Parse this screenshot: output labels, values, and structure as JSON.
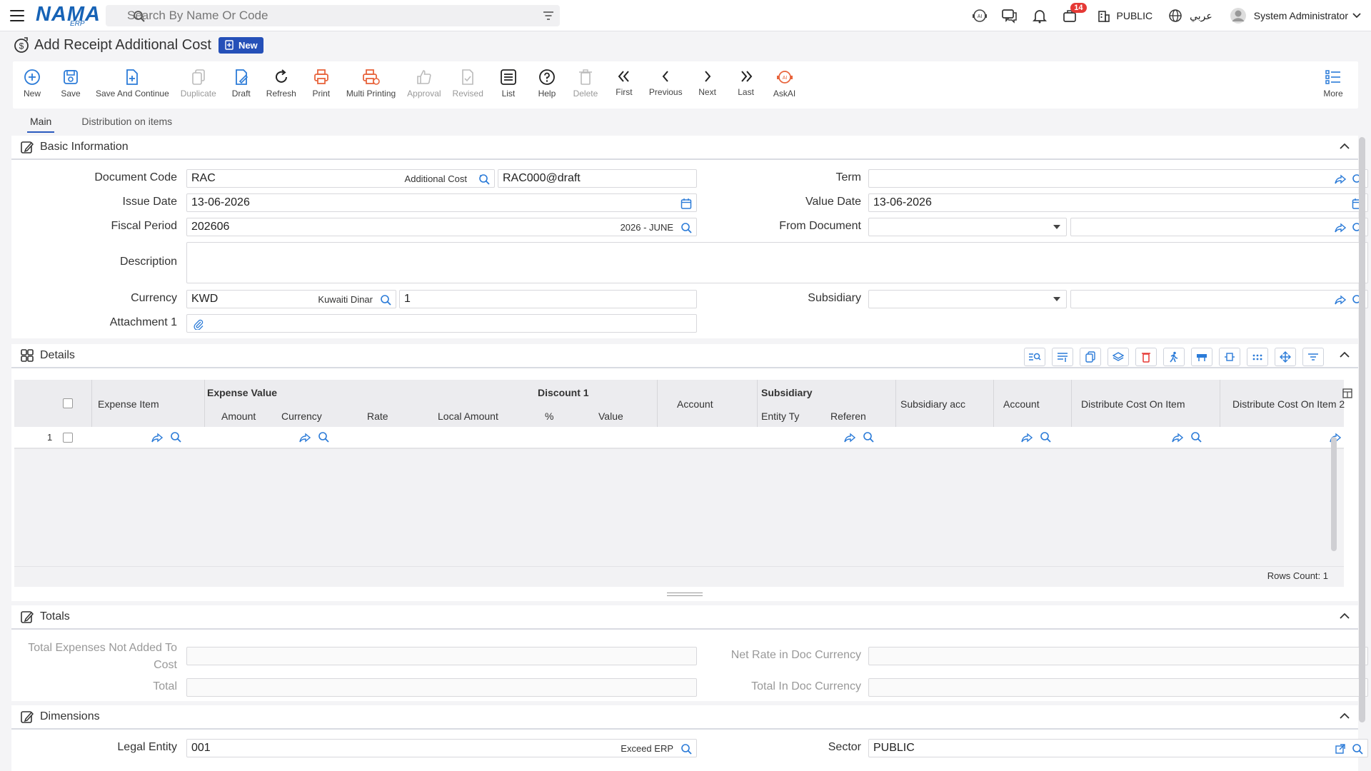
{
  "topbar": {
    "logo_main": "NAMA",
    "logo_sub": "ERP",
    "search_placeholder": "Search By Name Or Code",
    "notification_count": "14",
    "company": "PUBLIC",
    "language": "عربي",
    "user": "System Administrator"
  },
  "page": {
    "title": "Add Receipt Additional Cost",
    "status_badge": "New"
  },
  "toolbar": {
    "new": "New",
    "save": "Save",
    "save_continue": "Save And Continue",
    "duplicate": "Duplicate",
    "draft": "Draft",
    "refresh": "Refresh",
    "print": "Print",
    "multi_printing": "Multi Printing",
    "approval": "Approval",
    "revised": "Revised",
    "list": "List",
    "help": "Help",
    "delete": "Delete",
    "first": "First",
    "previous": "Previous",
    "next": "Next",
    "last": "Last",
    "askai": "AskAI",
    "more": "More"
  },
  "tabs": {
    "main": "Main",
    "distribution": "Distribution on items"
  },
  "basic": {
    "title": "Basic Information",
    "document_code_label": "Document Code",
    "document_code": "RAC",
    "document_code_tag": "Additional Cost",
    "document_number": "RAC000@draft",
    "term_label": "Term",
    "issue_date_label": "Issue Date",
    "issue_date": "13-06-2026",
    "value_date_label": "Value Date",
    "value_date": "13-06-2026",
    "fiscal_period_label": "Fiscal Period",
    "fiscal_period": "202606",
    "fiscal_period_tag": "2026 - JUNE",
    "from_document_label": "From Document",
    "description_label": "Description",
    "currency_label": "Currency",
    "currency": "KWD",
    "currency_tag": "Kuwaiti Dinar",
    "rate": "1",
    "subsidiary_label": "Subsidiary",
    "attachment_label": "Attachment 1"
  },
  "details": {
    "title": "Details",
    "columns": {
      "expense_item": "Expense Item",
      "expense_value": "Expense Value",
      "amount": "Amount",
      "currency": "Currency",
      "rate": "Rate",
      "local_amount": "Local Amount",
      "discount1": "Discount 1",
      "pct": "%",
      "value": "Value",
      "account": "Account",
      "subsidiary": "Subsidiary",
      "entity_type": "Entity Ty",
      "reference": "Referen",
      "subsidiary_account": "Subsidiary acc",
      "account2": "Account",
      "distribute_cost": "Distribute Cost On Item",
      "distribute_cost2": "Distribute Cost On Item 2"
    },
    "row_number": "1",
    "rows_count": "Rows Count: 1"
  },
  "totals": {
    "title": "Totals",
    "total_expenses_label_1": "Total Expenses Not Added To",
    "total_expenses_label_2": "Cost",
    "net_rate_label": "Net Rate in Doc Currency",
    "total_label": "Total",
    "total_doc_label": "Total In Doc Currency"
  },
  "dimensions": {
    "title": "Dimensions",
    "legal_entity_label": "Legal Entity",
    "legal_entity": "001",
    "legal_entity_tag": "Exceed ERP",
    "sector_label": "Sector",
    "sector": "PUBLIC"
  },
  "colors": {
    "brand": "#1763b6",
    "accent": "#2550b8",
    "orange": "#e8643c",
    "disabled": "#bbbbbb"
  }
}
